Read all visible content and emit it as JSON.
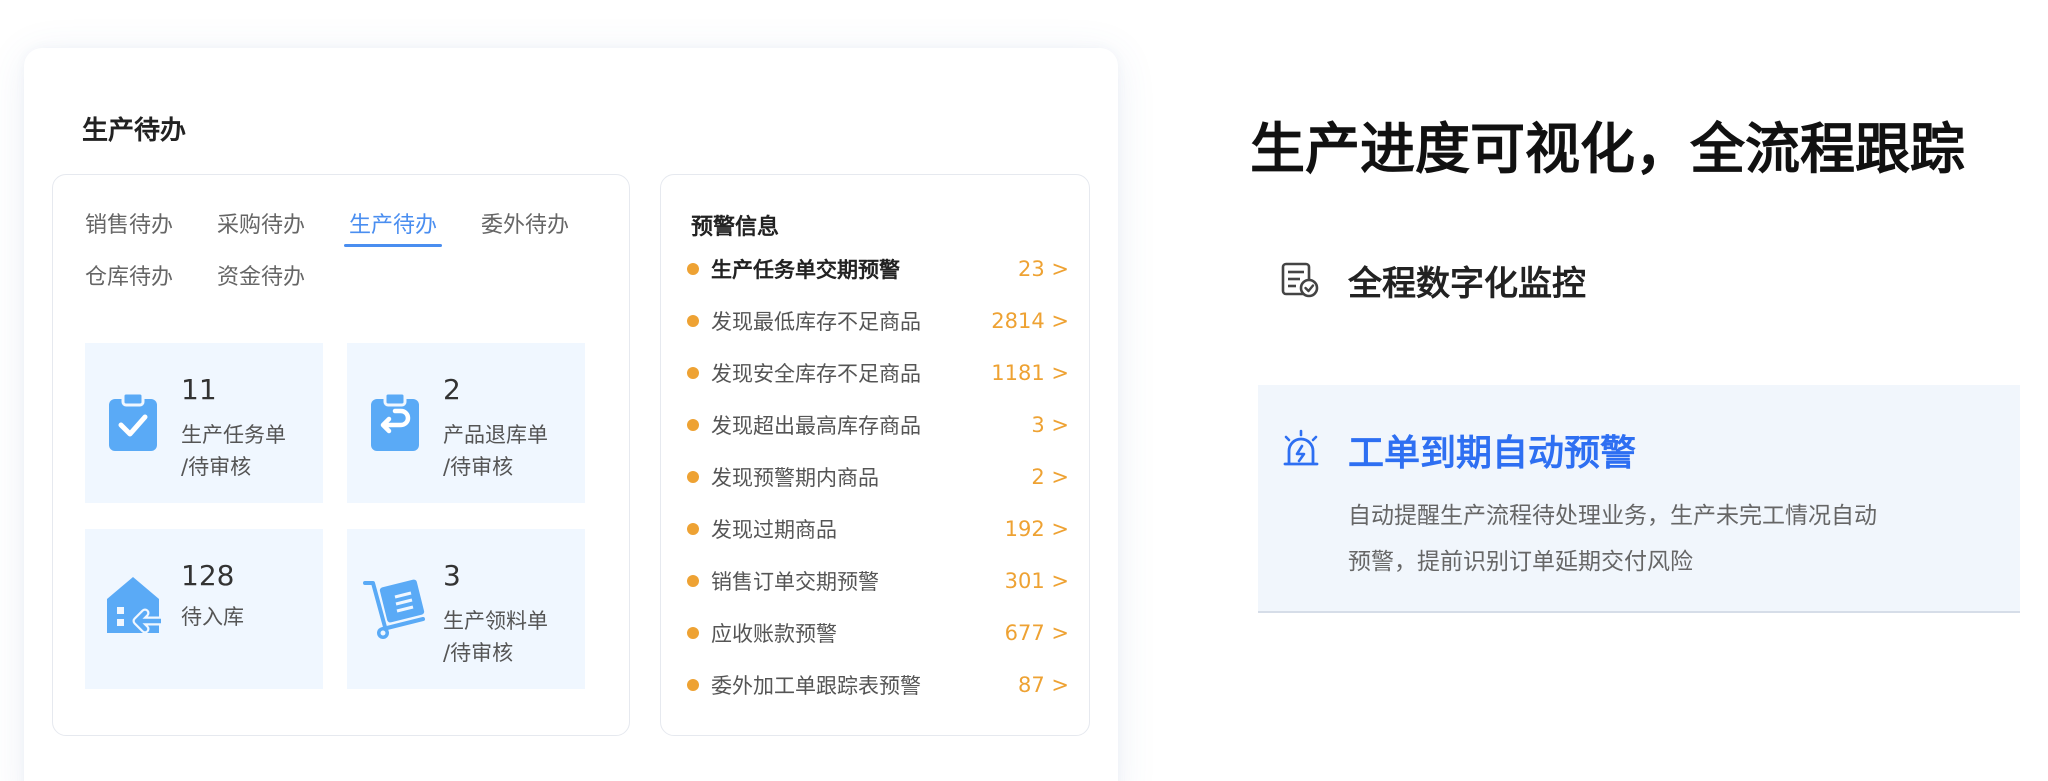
{
  "card": {
    "title": "生产待办",
    "tabs": [
      "销售待办",
      "采购待办",
      "生产待办",
      "委外待办",
      "仓库待办",
      "资金待办"
    ],
    "active_tab": "生产待办",
    "tiles": [
      {
        "num": "11",
        "line1": "生产任务单",
        "line2": "/待审核",
        "icon": "clipboard-check-icon"
      },
      {
        "num": "2",
        "line1": "产品退库单",
        "line2": "/待审核",
        "icon": "clipboard-return-icon"
      },
      {
        "num": "128",
        "line1": "待入库",
        "line2": "",
        "icon": "warehouse-in-icon"
      },
      {
        "num": "3",
        "line1": "生产领料单",
        "line2": "/待审核",
        "icon": "hand-cart-icon"
      }
    ]
  },
  "warnings": {
    "title": "预警信息",
    "items": [
      {
        "text": "生产任务单交期预警",
        "count": "23 >"
      },
      {
        "text": "发现最低库存不足商品",
        "count": "2814 >"
      },
      {
        "text": "发现安全库存不足商品",
        "count": "1181 >"
      },
      {
        "text": "发现超出最高库存商品",
        "count": "3 >"
      },
      {
        "text": "发现预警期内商品",
        "count": "2 >"
      },
      {
        "text": "发现过期商品",
        "count": "192 >"
      },
      {
        "text": "销售订单交期预警",
        "count": "301 >"
      },
      {
        "text": "应收账款预警",
        "count": "677 >"
      },
      {
        "text": "委外加工单跟踪表预警",
        "count": "87 >"
      }
    ]
  },
  "marketing": {
    "headline": "生产进度可视化，全流程跟踪",
    "feature1": {
      "title": "全程数字化监控",
      "icon": "monitor-list-icon"
    },
    "feature2": {
      "title": "工单到期自动预警",
      "icon": "alarm-light-icon",
      "desc_line1": "自动提醒生产流程待处理业务，生产未完工情况自动",
      "desc_line2": "预警，提前识别订单延期交付风险"
    }
  },
  "colors": {
    "accent": "#4a8ef0",
    "warning": "#eea233",
    "tile_bg": "#f0f7ff",
    "icon_blue": "#5aaaf6",
    "feature_blue": "#2e6ff2"
  }
}
